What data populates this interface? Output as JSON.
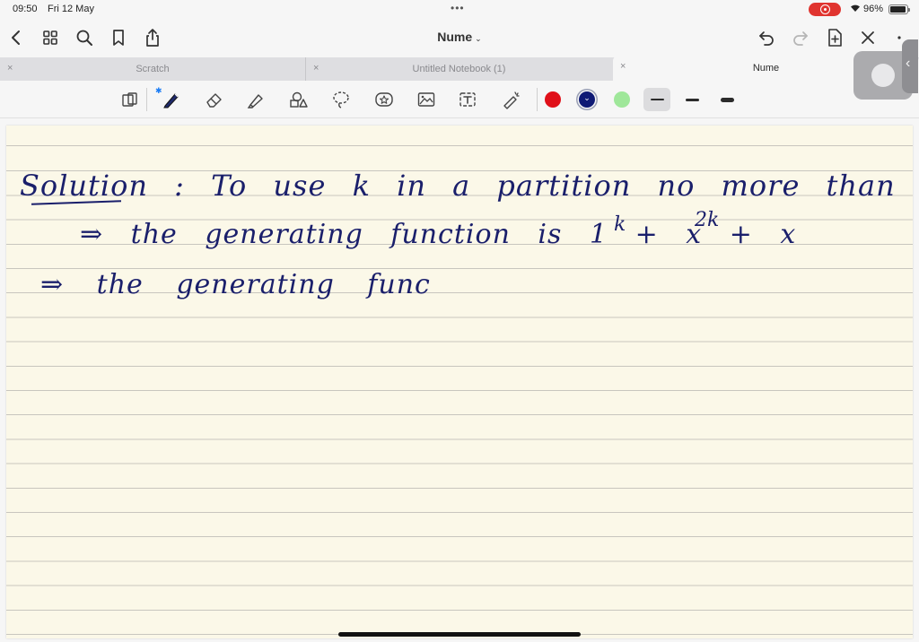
{
  "status": {
    "time": "09:50",
    "date": "Fri 12 May",
    "battery": "96%"
  },
  "nav": {
    "title": "Nume"
  },
  "tabs": [
    {
      "label": "Scratch",
      "active": false
    },
    {
      "label": "Untitled Notebook (1)",
      "active": false
    },
    {
      "label": "Nume",
      "active": true
    }
  ],
  "toolbar": {
    "tools": [
      "zoom-window-icon",
      "pen-icon",
      "eraser-icon",
      "highlighter-icon",
      "shapes-icon",
      "lasso-icon",
      "sticker-icon",
      "image-icon",
      "text-box-icon",
      "laser-pointer-icon"
    ],
    "colors": [
      "#e01019",
      "#0f1a75",
      "#9fe79a"
    ],
    "selected_color": "#0f1a75",
    "thickness_selected": 0
  },
  "notes": {
    "line1": "Solution : To use k in a partition no more than twice",
    "line2": "⇒ the generating function is 1 + x  + x",
    "line2_exp1": "k",
    "line2_exp2": "2k",
    "line3": "⇒ the generating func"
  }
}
